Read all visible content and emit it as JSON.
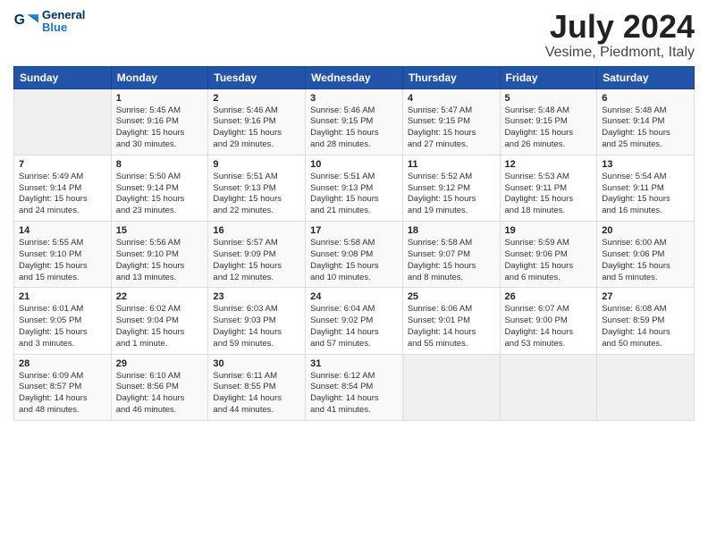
{
  "header": {
    "logo_line1": "General",
    "logo_line2": "Blue",
    "title": "July 2024",
    "subtitle": "Vesime, Piedmont, Italy"
  },
  "weekdays": [
    "Sunday",
    "Monday",
    "Tuesday",
    "Wednesday",
    "Thursday",
    "Friday",
    "Saturday"
  ],
  "weeks": [
    [
      {
        "day": "",
        "info": ""
      },
      {
        "day": "1",
        "info": "Sunrise: 5:45 AM\nSunset: 9:16 PM\nDaylight: 15 hours\nand 30 minutes."
      },
      {
        "day": "2",
        "info": "Sunrise: 5:46 AM\nSunset: 9:16 PM\nDaylight: 15 hours\nand 29 minutes."
      },
      {
        "day": "3",
        "info": "Sunrise: 5:46 AM\nSunset: 9:15 PM\nDaylight: 15 hours\nand 28 minutes."
      },
      {
        "day": "4",
        "info": "Sunrise: 5:47 AM\nSunset: 9:15 PM\nDaylight: 15 hours\nand 27 minutes."
      },
      {
        "day": "5",
        "info": "Sunrise: 5:48 AM\nSunset: 9:15 PM\nDaylight: 15 hours\nand 26 minutes."
      },
      {
        "day": "6",
        "info": "Sunrise: 5:48 AM\nSunset: 9:14 PM\nDaylight: 15 hours\nand 25 minutes."
      }
    ],
    [
      {
        "day": "7",
        "info": "Sunrise: 5:49 AM\nSunset: 9:14 PM\nDaylight: 15 hours\nand 24 minutes."
      },
      {
        "day": "8",
        "info": "Sunrise: 5:50 AM\nSunset: 9:14 PM\nDaylight: 15 hours\nand 23 minutes."
      },
      {
        "day": "9",
        "info": "Sunrise: 5:51 AM\nSunset: 9:13 PM\nDaylight: 15 hours\nand 22 minutes."
      },
      {
        "day": "10",
        "info": "Sunrise: 5:51 AM\nSunset: 9:13 PM\nDaylight: 15 hours\nand 21 minutes."
      },
      {
        "day": "11",
        "info": "Sunrise: 5:52 AM\nSunset: 9:12 PM\nDaylight: 15 hours\nand 19 minutes."
      },
      {
        "day": "12",
        "info": "Sunrise: 5:53 AM\nSunset: 9:11 PM\nDaylight: 15 hours\nand 18 minutes."
      },
      {
        "day": "13",
        "info": "Sunrise: 5:54 AM\nSunset: 9:11 PM\nDaylight: 15 hours\nand 16 minutes."
      }
    ],
    [
      {
        "day": "14",
        "info": "Sunrise: 5:55 AM\nSunset: 9:10 PM\nDaylight: 15 hours\nand 15 minutes."
      },
      {
        "day": "15",
        "info": "Sunrise: 5:56 AM\nSunset: 9:10 PM\nDaylight: 15 hours\nand 13 minutes."
      },
      {
        "day": "16",
        "info": "Sunrise: 5:57 AM\nSunset: 9:09 PM\nDaylight: 15 hours\nand 12 minutes."
      },
      {
        "day": "17",
        "info": "Sunrise: 5:58 AM\nSunset: 9:08 PM\nDaylight: 15 hours\nand 10 minutes."
      },
      {
        "day": "18",
        "info": "Sunrise: 5:58 AM\nSunset: 9:07 PM\nDaylight: 15 hours\nand 8 minutes."
      },
      {
        "day": "19",
        "info": "Sunrise: 5:59 AM\nSunset: 9:06 PM\nDaylight: 15 hours\nand 6 minutes."
      },
      {
        "day": "20",
        "info": "Sunrise: 6:00 AM\nSunset: 9:06 PM\nDaylight: 15 hours\nand 5 minutes."
      }
    ],
    [
      {
        "day": "21",
        "info": "Sunrise: 6:01 AM\nSunset: 9:05 PM\nDaylight: 15 hours\nand 3 minutes."
      },
      {
        "day": "22",
        "info": "Sunrise: 6:02 AM\nSunset: 9:04 PM\nDaylight: 15 hours\nand 1 minute."
      },
      {
        "day": "23",
        "info": "Sunrise: 6:03 AM\nSunset: 9:03 PM\nDaylight: 14 hours\nand 59 minutes."
      },
      {
        "day": "24",
        "info": "Sunrise: 6:04 AM\nSunset: 9:02 PM\nDaylight: 14 hours\nand 57 minutes."
      },
      {
        "day": "25",
        "info": "Sunrise: 6:06 AM\nSunset: 9:01 PM\nDaylight: 14 hours\nand 55 minutes."
      },
      {
        "day": "26",
        "info": "Sunrise: 6:07 AM\nSunset: 9:00 PM\nDaylight: 14 hours\nand 53 minutes."
      },
      {
        "day": "27",
        "info": "Sunrise: 6:08 AM\nSunset: 8:59 PM\nDaylight: 14 hours\nand 50 minutes."
      }
    ],
    [
      {
        "day": "28",
        "info": "Sunrise: 6:09 AM\nSunset: 8:57 PM\nDaylight: 14 hours\nand 48 minutes."
      },
      {
        "day": "29",
        "info": "Sunrise: 6:10 AM\nSunset: 8:56 PM\nDaylight: 14 hours\nand 46 minutes."
      },
      {
        "day": "30",
        "info": "Sunrise: 6:11 AM\nSunset: 8:55 PM\nDaylight: 14 hours\nand 44 minutes."
      },
      {
        "day": "31",
        "info": "Sunrise: 6:12 AM\nSunset: 8:54 PM\nDaylight: 14 hours\nand 41 minutes."
      },
      {
        "day": "",
        "info": ""
      },
      {
        "day": "",
        "info": ""
      },
      {
        "day": "",
        "info": ""
      }
    ]
  ]
}
